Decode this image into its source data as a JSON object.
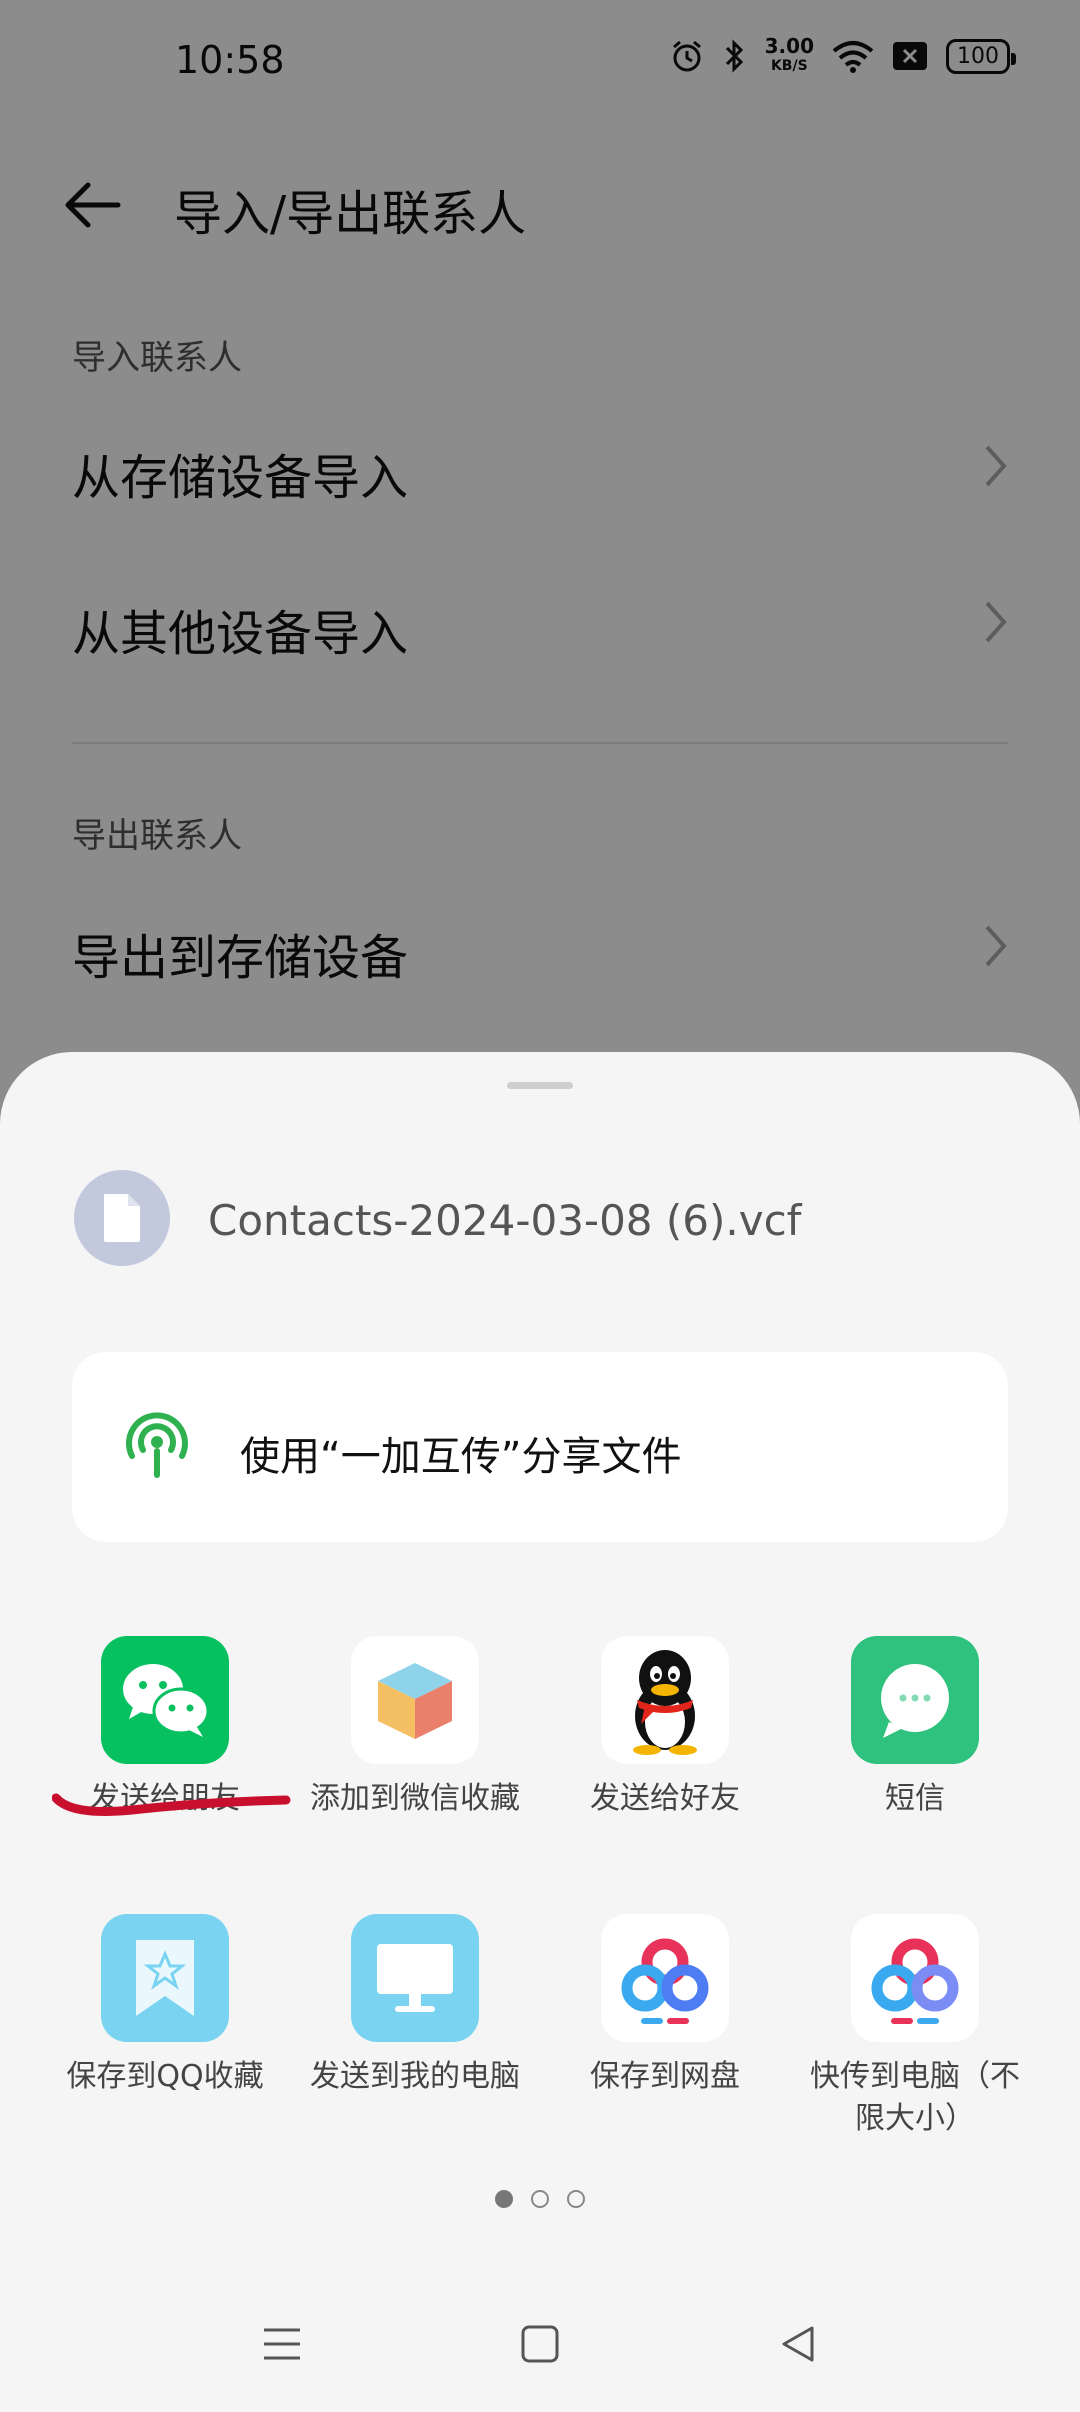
{
  "status_bar": {
    "time": "10:58",
    "speed_value": "3.00",
    "speed_unit": "KB/S",
    "battery": "100"
  },
  "header": {
    "title": "导入/导出联系人"
  },
  "sections": {
    "import_label": "导入联系人",
    "import_items": [
      "从存储设备导入",
      "从其他设备导入"
    ],
    "export_label": "导出联系人",
    "export_items": [
      "导出到存储设备"
    ]
  },
  "share_sheet": {
    "file_name": "Contacts-2024-03-08 (6).vcf",
    "share_card_text": "使用“一加互传”分享文件",
    "apps": [
      {
        "label": "发送给朋友",
        "icon": "wechat-icon"
      },
      {
        "label": "添加到微信收藏",
        "icon": "wechat-favorites-icon"
      },
      {
        "label": "发送给好友",
        "icon": "qq-icon"
      },
      {
        "label": "短信",
        "icon": "sms-icon"
      },
      {
        "label": "保存到QQ收藏",
        "icon": "qq-favorites-icon"
      },
      {
        "label": "发送到我的电脑",
        "icon": "my-computer-icon"
      },
      {
        "label": "保存到网盘",
        "icon": "netdisk-icon"
      },
      {
        "label": "快传到电脑（不限大小）",
        "icon": "netdisk-transfer-icon"
      }
    ],
    "page_indicator": {
      "pages": 3,
      "current": 1
    }
  },
  "colors": {
    "wechat_green": "#07c160",
    "sms_green": "#2ec27e",
    "qq_blue": "#7ad3f0",
    "annotation_red": "#c8102e"
  }
}
